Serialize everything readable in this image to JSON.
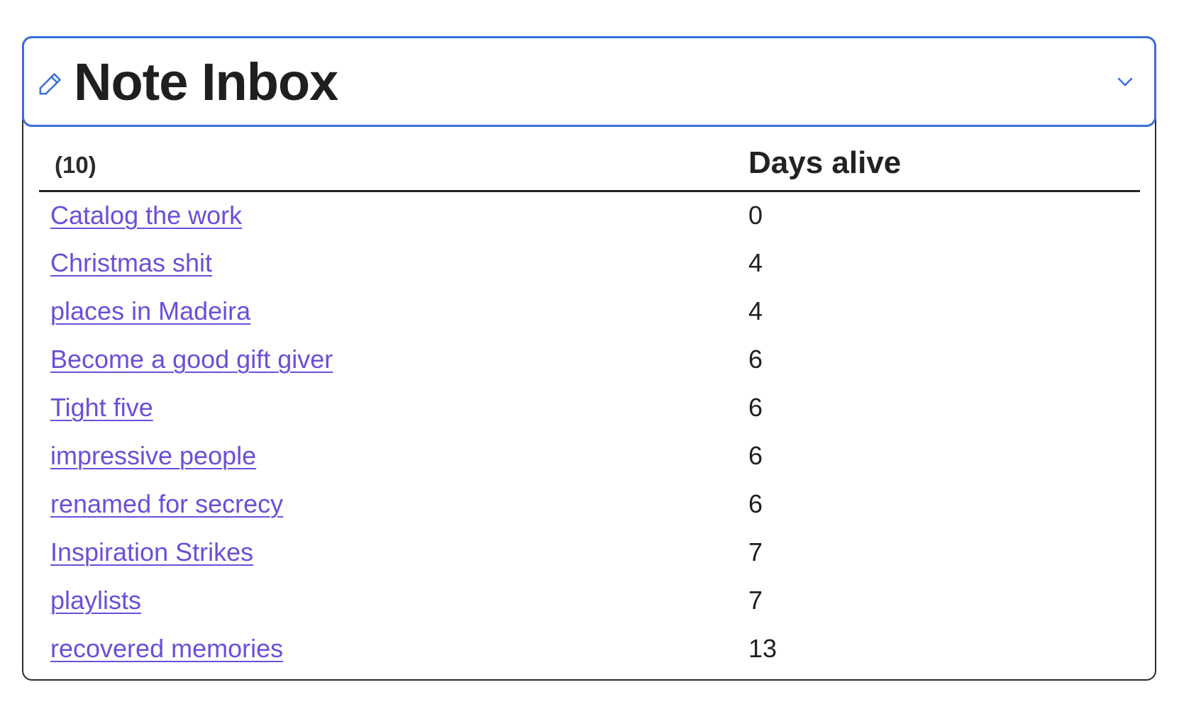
{
  "widget": {
    "title": "Note Inbox",
    "header_icon": "pencil-icon",
    "toggle_icon": "chevron-down-icon",
    "accent_color": "#3a6fd8",
    "link_color": "#6b4fd8"
  },
  "table": {
    "count_label": "(10)",
    "days_header": "Days alive",
    "rows": [
      {
        "name": "Catalog the work",
        "days": "0"
      },
      {
        "name": "Christmas shit",
        "days": "4"
      },
      {
        "name": "places in Madeira",
        "days": "4"
      },
      {
        "name": "Become a good gift giver",
        "days": "6"
      },
      {
        "name": "Tight five",
        "days": "6"
      },
      {
        "name": "impressive people",
        "days": "6"
      },
      {
        "name": "renamed for secrecy",
        "days": "6"
      },
      {
        "name": "Inspiration Strikes",
        "days": "7"
      },
      {
        "name": "playlists",
        "days": "7"
      },
      {
        "name": "recovered memories",
        "days": "13"
      }
    ]
  }
}
